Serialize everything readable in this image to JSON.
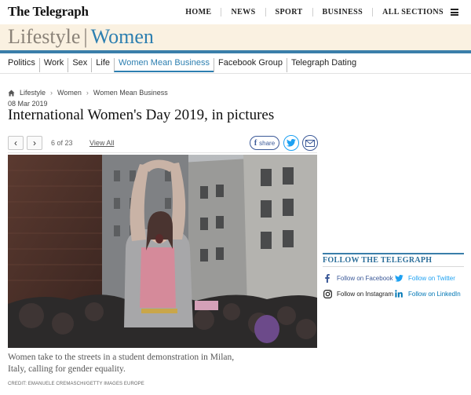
{
  "header": {
    "logo": "The Telegraph",
    "nav": [
      "HOME",
      "NEWS",
      "SPORT",
      "BUSINESS",
      "ALL SECTIONS"
    ]
  },
  "section": {
    "primary": "Lifestyle",
    "divider": "|",
    "secondary": "Women"
  },
  "subnav": {
    "items": [
      "Politics",
      "Work",
      "Sex",
      "Life",
      "Women Mean Business",
      "Facebook Group",
      "Telegraph Dating"
    ],
    "active": "Women Mean Business"
  },
  "breadcrumb": {
    "items": [
      "Lifestyle",
      "Women",
      "Women Mean Business"
    ]
  },
  "article": {
    "date": "08 Mar 2019",
    "headline": "International Women's Day 2019, in pictures"
  },
  "gallery": {
    "prev": "‹",
    "next": "›",
    "counter": "6 of 23",
    "view_all": "View All",
    "share_label": "share",
    "share_fb": "f",
    "caption": "Women take to the streets in a student demonstration in Milan, Italy, calling for gender equality.",
    "credit": "CREDIT: EMANUELE CREMASCHI/GETTY IMAGES EUROPE"
  },
  "follow": {
    "title": "FOLLOW THE TELEGRAPH",
    "links": [
      "Follow on Facebook",
      "Follow on Twitter",
      "Follow on Instagram",
      "Follow on LinkedIn"
    ]
  },
  "colors": {
    "accent": "#2d7fb0",
    "band": "#faf1e1",
    "facebook": "#3b5998",
    "twitter": "#1da1f2",
    "linkedin": "#0077b5"
  }
}
